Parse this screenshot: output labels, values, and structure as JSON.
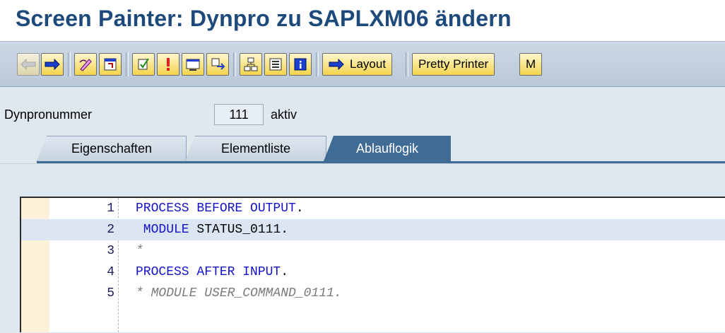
{
  "window": {
    "title": "Screen Painter: Dynpro zu SAPLXM06 ändern"
  },
  "toolbar": {
    "icons": [
      {
        "name": "back-arrow-icon",
        "enabled": false
      },
      {
        "name": "forward-arrow-icon",
        "enabled": true
      },
      {
        "name": "edit-display-toggle-icon",
        "enabled": true
      },
      {
        "name": "other-object-icon",
        "enabled": true
      },
      {
        "name": "check-icon",
        "enabled": true
      },
      {
        "name": "activate-icon",
        "enabled": true
      },
      {
        "name": "where-used-icon",
        "enabled": true
      },
      {
        "name": "navigate-icon",
        "enabled": true
      },
      {
        "name": "hierarchy-icon",
        "enabled": true
      },
      {
        "name": "element-list-icon",
        "enabled": true
      },
      {
        "name": "info-icon",
        "enabled": true
      }
    ],
    "layout_label": "Layout",
    "pretty_printer_label": "Pretty Printer",
    "next_label_partial": "M"
  },
  "dynpro": {
    "label": "Dynpronummer",
    "number": "111",
    "status": "aktiv"
  },
  "tabs": [
    {
      "label": "Eigenschaften",
      "active": false
    },
    {
      "label": "Elementliste",
      "active": false
    },
    {
      "label": "Ablauflogik",
      "active": true
    }
  ],
  "code_lines": [
    {
      "num": "1",
      "segments": [
        {
          "t": "PROCESS BEFORE OUTPUT",
          "k": "kw"
        },
        {
          "t": ".",
          "k": "plain"
        }
      ]
    },
    {
      "num": "2",
      "segments": [
        {
          "t": " MODULE",
          "k": "kw"
        },
        {
          "t": " STATUS_0111.",
          "k": "plain"
        }
      ],
      "highlight": true
    },
    {
      "num": "3",
      "segments": [
        {
          "t": "*",
          "k": "comment"
        }
      ]
    },
    {
      "num": "4",
      "segments": [
        {
          "t": "PROCESS AFTER INPUT",
          "k": "kw"
        },
        {
          "t": ".",
          "k": "plain"
        }
      ]
    },
    {
      "num": "5",
      "segments": [
        {
          "t": "* MODULE USER_COMMAND_0111.",
          "k": "comment"
        }
      ]
    }
  ],
  "colors": {
    "title": "#1e4a7b",
    "active_tab": "#3f6b95",
    "keyword": "#1313c7",
    "comment": "#7a7a7a",
    "highlight_row": "#dce6f2"
  }
}
